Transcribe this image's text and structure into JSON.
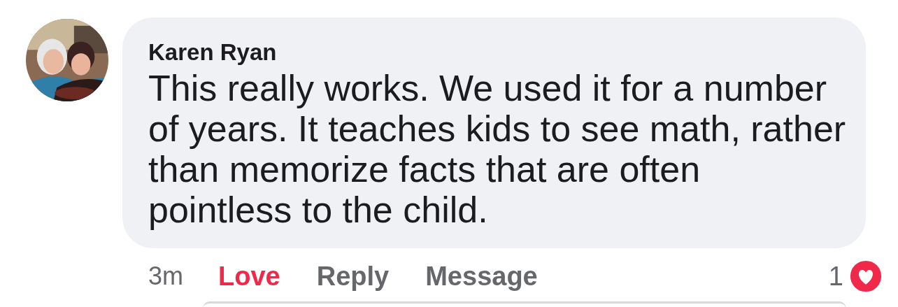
{
  "comment": {
    "author": "Karen Ryan",
    "text": "This really works. We used it for a number of years. It teaches kids to see math, rather than memorize facts that are often pointless to the child.",
    "time": "3m",
    "actions": [
      {
        "label": "Love",
        "kind": "reaction",
        "active": true
      },
      {
        "label": "Reply",
        "kind": "reply",
        "active": false
      },
      {
        "label": "Message",
        "kind": "message",
        "active": false
      }
    ],
    "reactions": {
      "count": "1"
    }
  }
}
